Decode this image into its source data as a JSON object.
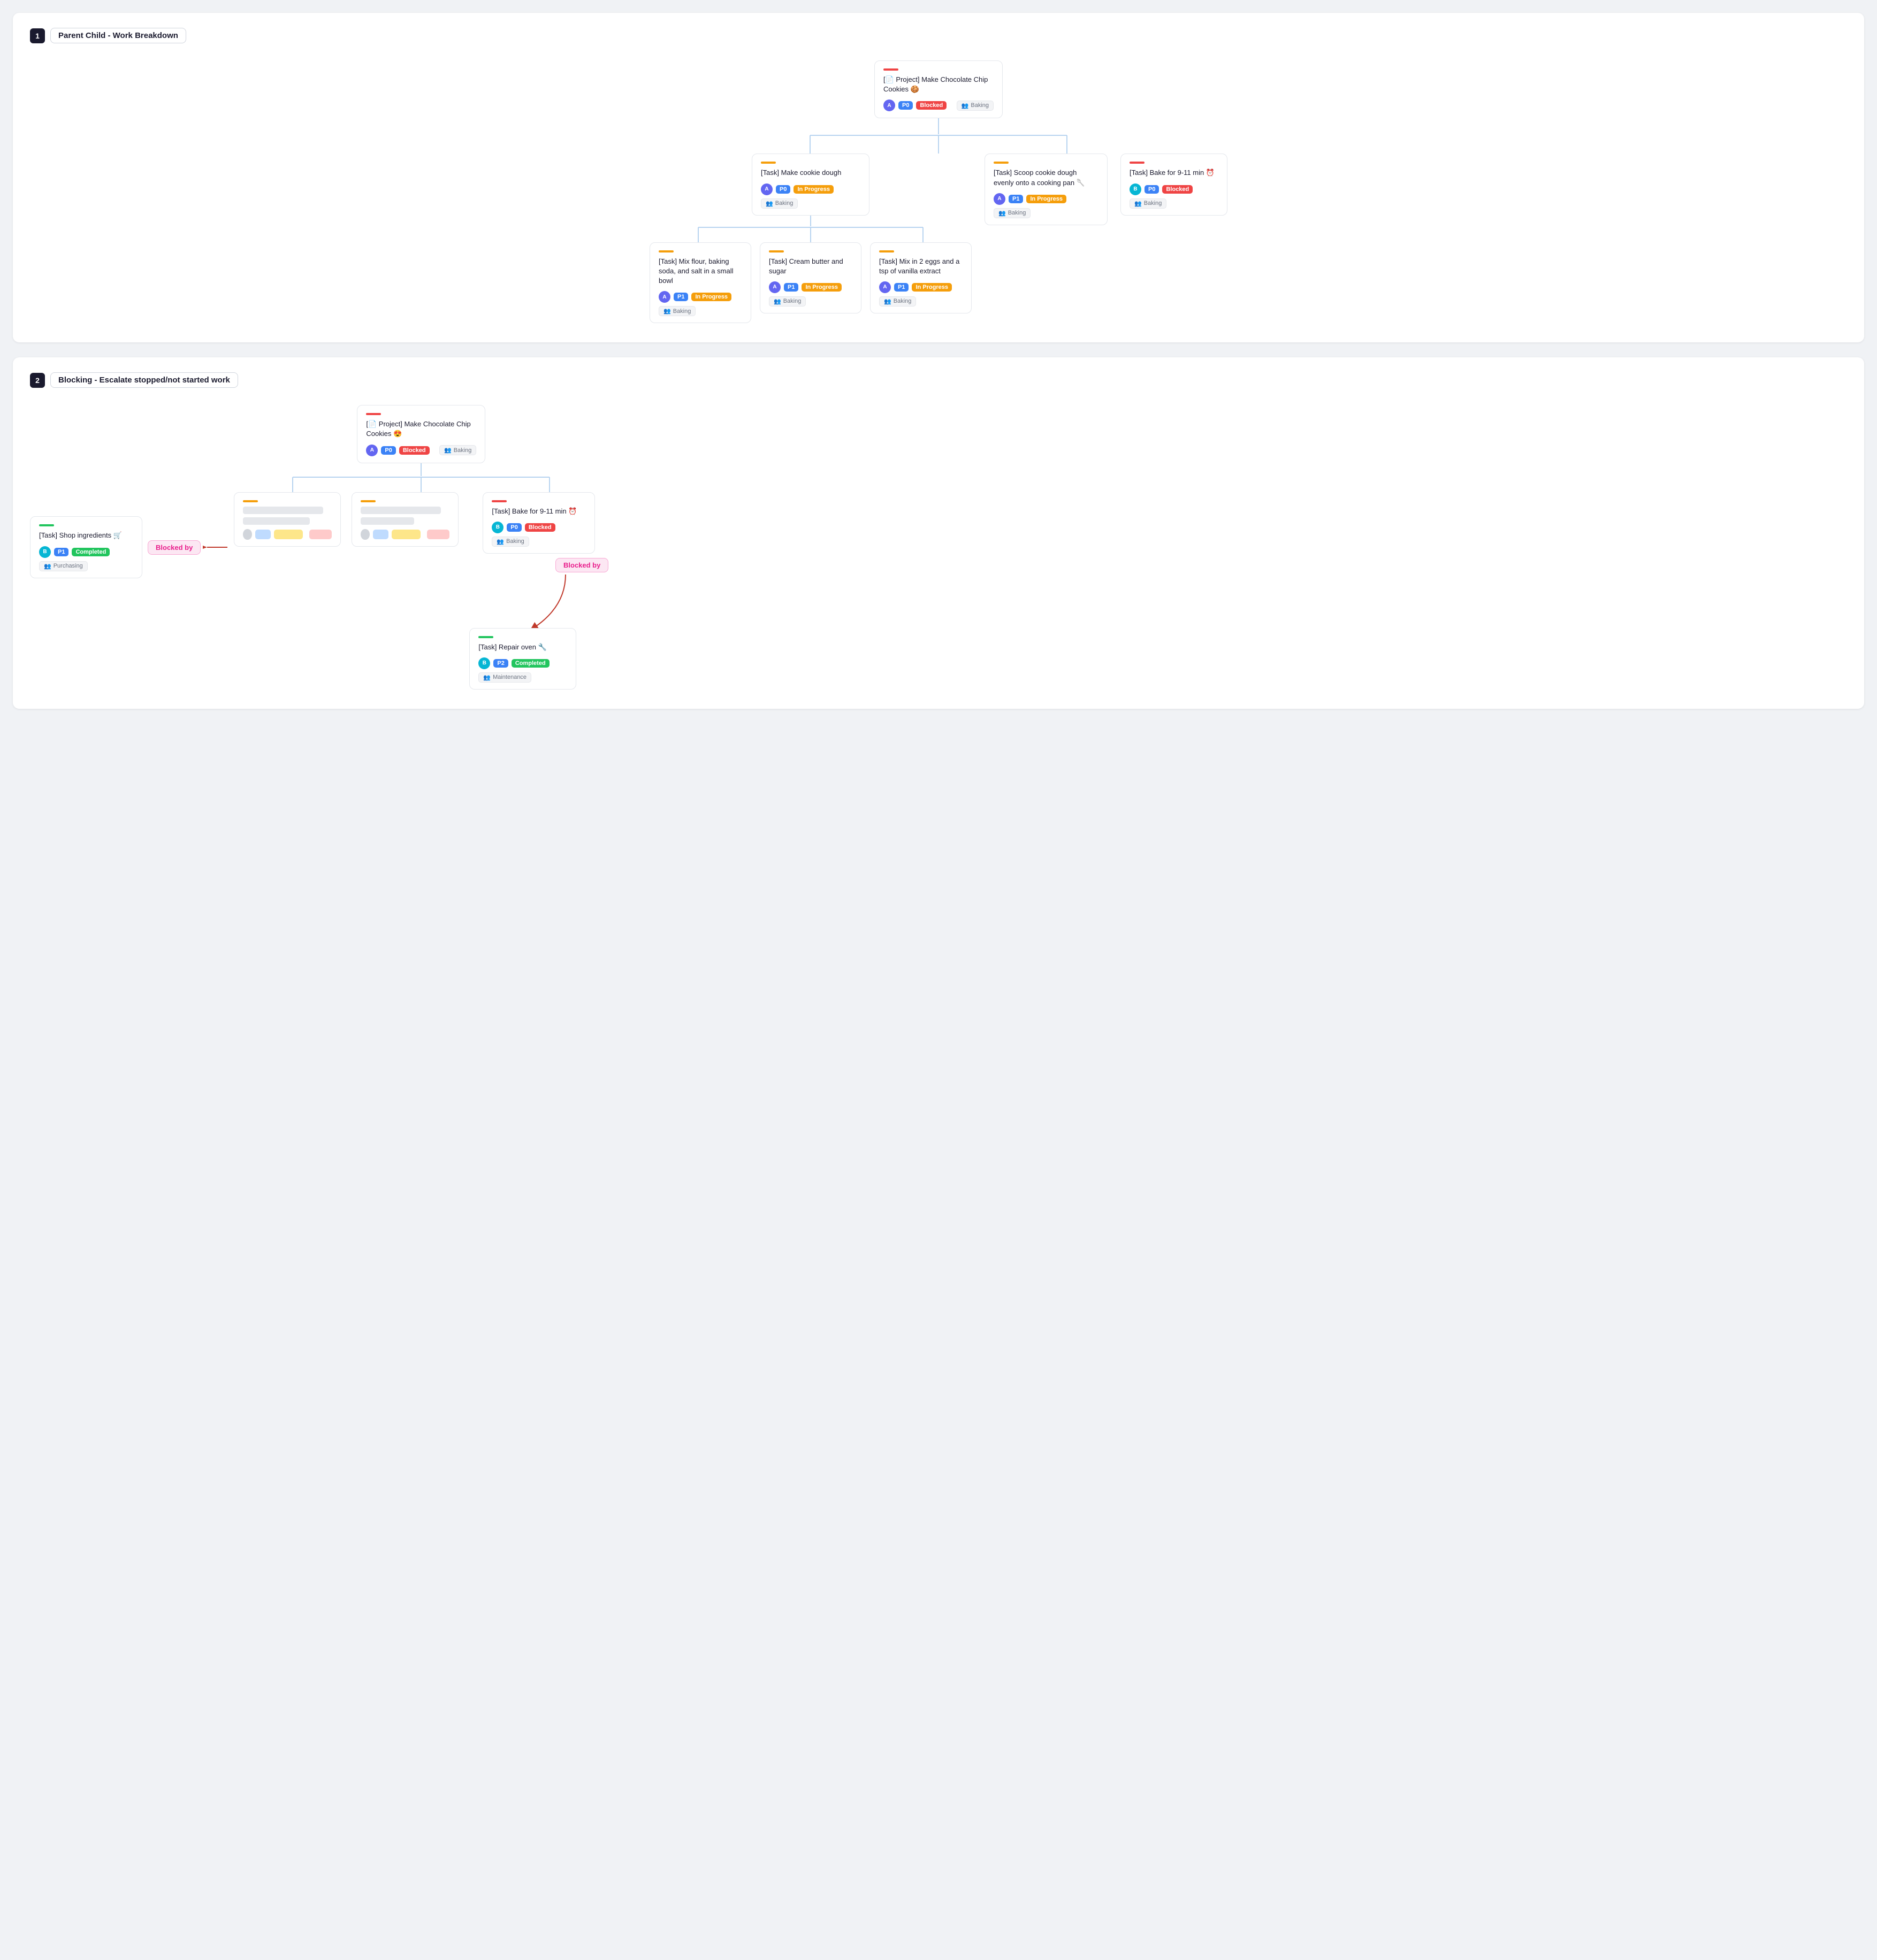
{
  "sections": [
    {
      "num": "1",
      "title": "Parent Child - Work Breakdown",
      "root_card": {
        "accent_color": "#ef4444",
        "title": "[📄 Project] Make Chocolate Chip Cookies 🍪",
        "avatar_color": "#6366f1",
        "avatar_text": "A",
        "priority": "P0",
        "priority_class": "badge-p0",
        "status": "Blocked",
        "status_class": "badge-blocked",
        "team": "Baking",
        "team_icon": "👥"
      },
      "level1_cards": [
        {
          "accent_color": "#f59e0b",
          "title": "[Task] Make cookie dough",
          "avatar_color": "#6366f1",
          "avatar_text": "A",
          "priority": "P0",
          "priority_class": "badge-p0",
          "status": "In Progress",
          "status_class": "badge-inprogress",
          "team": "Baking",
          "has_children": true
        },
        {
          "accent_color": "#f59e0b",
          "title": "[Task] Scoop cookie dough evenly onto a cooking pan 🥄",
          "avatar_color": "#6366f1",
          "avatar_text": "A",
          "priority": "P1",
          "priority_class": "badge-p1",
          "status": "In Progress",
          "status_class": "badge-inprogress",
          "team": "Baking",
          "has_children": false
        },
        {
          "accent_color": "#ef4444",
          "title": "[Task] Bake for 9-11 min ⏰",
          "avatar_color": "#06b6d4",
          "avatar_text": "B",
          "priority": "P0",
          "priority_class": "badge-p0",
          "status": "Blocked",
          "status_class": "badge-blocked",
          "team": "Baking",
          "has_children": false
        }
      ],
      "level2_cards": [
        {
          "accent_color": "#f59e0b",
          "title": "[Task] Mix flour, baking soda, and salt in a small bowl",
          "avatar_color": "#6366f1",
          "avatar_text": "A",
          "priority": "P1",
          "priority_class": "badge-p1",
          "status": "In Progress",
          "status_class": "badge-inprogress",
          "team": "Baking"
        },
        {
          "accent_color": "#f59e0b",
          "title": "[Task] Cream butter and sugar",
          "avatar_color": "#6366f1",
          "avatar_text": "A",
          "priority": "P1",
          "priority_class": "badge-p1",
          "status": "In Progress",
          "status_class": "badge-inprogress",
          "team": "Baking"
        },
        {
          "accent_color": "#f59e0b",
          "title": "[Task] Mix in 2 eggs and a tsp of vanilla extract",
          "avatar_color": "#6366f1",
          "avatar_text": "A",
          "priority": "P1",
          "priority_class": "badge-p1",
          "status": "In Progress",
          "status_class": "badge-inprogress",
          "team": "Baking"
        }
      ]
    },
    {
      "num": "2",
      "title": "Blocking - Escalate stopped/not started work",
      "shop_card": {
        "accent_color": "#22c55e",
        "title": "[Task] Shop ingredients 🛒",
        "avatar_color": "#06b6d4",
        "avatar_text": "B",
        "priority": "P1",
        "priority_class": "badge-p1",
        "status": "Completed",
        "status_class": "badge-completed",
        "team": "Purchasing",
        "team_icon": "👥"
      },
      "blocked_by_label": "Blocked by",
      "root_card2": {
        "accent_color": "#ef4444",
        "title": "[📄 Project] Make Chocolate Chip Cookies 😍",
        "avatar_color": "#6366f1",
        "avatar_text": "A",
        "priority": "P0",
        "priority_class": "badge-p0",
        "status": "Blocked",
        "status_class": "badge-blocked",
        "team": "Baking",
        "team_icon": "👥"
      },
      "bake_card": {
        "accent_color": "#ef4444",
        "title": "[Task] Bake for 9-11 min ⏰",
        "avatar_color": "#06b6d4",
        "avatar_text": "B",
        "priority": "P0",
        "priority_class": "badge-p0",
        "status": "Blocked",
        "status_class": "badge-blocked",
        "team": "Baking",
        "team_icon": "👥"
      },
      "repair_card": {
        "accent_color": "#22c55e",
        "title": "[Task] Repair oven 🔧",
        "avatar_color": "#06b6d4",
        "avatar_text": "B",
        "priority": "P2",
        "priority_class": "badge-p2",
        "status": "Completed",
        "status_class": "badge-completed",
        "team": "Maintenance",
        "team_icon": "👥"
      },
      "blocked_by_label2": "Blocked by"
    }
  ]
}
